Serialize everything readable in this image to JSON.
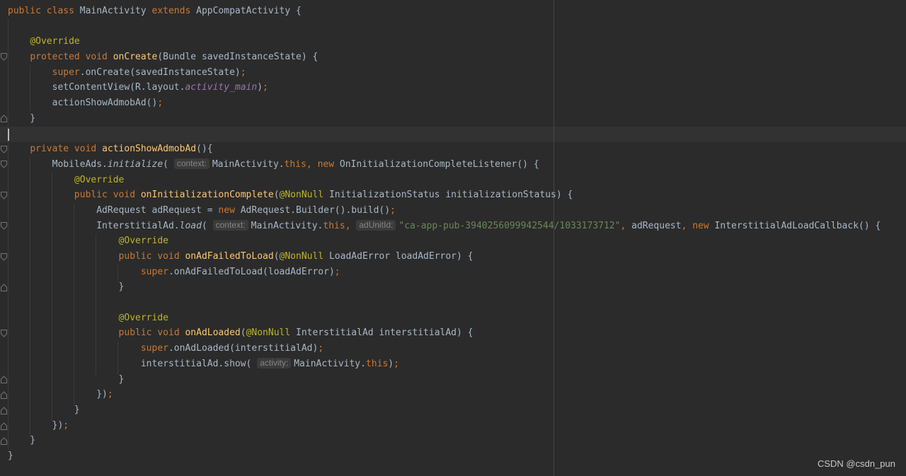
{
  "editor": {
    "language": "java",
    "colors": {
      "background": "#2b2b2b",
      "current_line": "#323232",
      "plain": "#a9b7c6",
      "keyword": "#cc7832",
      "annotation": "#bbb529",
      "method_declaration": "#ffc66d",
      "field": "#9876aa",
      "string": "#6a8759",
      "inlay_hint_text": "#858585",
      "inlay_hint_background": "#3b3b3b"
    },
    "lines": [
      [
        {
          "t": "keyword",
          "v": "public class "
        },
        {
          "t": "plain",
          "v": "MainActivity "
        },
        {
          "t": "keyword",
          "v": "extends "
        },
        {
          "t": "plain",
          "v": "AppCompatActivity {"
        }
      ],
      [],
      [
        {
          "t": "plain",
          "v": "    "
        },
        {
          "t": "annotation",
          "v": "@Override"
        }
      ],
      [
        {
          "t": "plain",
          "v": "    "
        },
        {
          "t": "keyword",
          "v": "protected void "
        },
        {
          "t": "method-decl",
          "v": "onCreate"
        },
        {
          "t": "plain",
          "v": "(Bundle savedInstanceState) {"
        }
      ],
      [
        {
          "t": "plain",
          "v": "        "
        },
        {
          "t": "keyword",
          "v": "super"
        },
        {
          "t": "plain",
          "v": ".onCreate(savedInstanceState)"
        },
        {
          "t": "punct",
          "v": ";"
        }
      ],
      [
        {
          "t": "plain",
          "v": "        setContentView(R.layout."
        },
        {
          "t": "field-ref",
          "v": "activity_main"
        },
        {
          "t": "plain",
          "v": ")"
        },
        {
          "t": "punct",
          "v": ";"
        }
      ],
      [
        {
          "t": "plain",
          "v": "        actionShowAdmobAd()"
        },
        {
          "t": "punct",
          "v": ";"
        }
      ],
      [
        {
          "t": "plain",
          "v": "    }"
        }
      ],
      [],
      [
        {
          "t": "plain",
          "v": "    "
        },
        {
          "t": "keyword",
          "v": "private void "
        },
        {
          "t": "method-decl",
          "v": "actionShowAdmobAd"
        },
        {
          "t": "plain",
          "v": "(){"
        }
      ],
      [
        {
          "t": "plain",
          "v": "        MobileAds."
        },
        {
          "t": "static-call",
          "v": "initialize"
        },
        {
          "t": "plain",
          "v": "( "
        },
        {
          "t": "hint",
          "v": "context:"
        },
        {
          "t": "plain",
          "v": "MainActivity."
        },
        {
          "t": "keyword",
          "v": "this, new "
        },
        {
          "t": "plain",
          "v": "OnInitializationCompleteListener() {"
        }
      ],
      [
        {
          "t": "plain",
          "v": "            "
        },
        {
          "t": "annotation",
          "v": "@Override"
        }
      ],
      [
        {
          "t": "plain",
          "v": "            "
        },
        {
          "t": "keyword",
          "v": "public void "
        },
        {
          "t": "method-decl",
          "v": "onInitializationComplete"
        },
        {
          "t": "plain",
          "v": "("
        },
        {
          "t": "annotation",
          "v": "@NonNull "
        },
        {
          "t": "plain",
          "v": "InitializationStatus initializationStatus) {"
        }
      ],
      [
        {
          "t": "plain",
          "v": "                AdRequest adRequest = "
        },
        {
          "t": "keyword",
          "v": "new "
        },
        {
          "t": "plain",
          "v": "AdRequest.Builder().build()"
        },
        {
          "t": "punct",
          "v": ";"
        }
      ],
      [
        {
          "t": "plain",
          "v": "                InterstitialAd."
        },
        {
          "t": "static-call",
          "v": "load"
        },
        {
          "t": "plain",
          "v": "( "
        },
        {
          "t": "hint",
          "v": "context:"
        },
        {
          "t": "plain",
          "v": "MainActivity."
        },
        {
          "t": "keyword",
          "v": "this, "
        },
        {
          "t": "hint",
          "v": "adUnitId:"
        },
        {
          "t": "string",
          "v": "\"ca-app-pub-3940256099942544/1033173712\""
        },
        {
          "t": "punct",
          "v": ", "
        },
        {
          "t": "plain",
          "v": "adRequest"
        },
        {
          "t": "punct",
          "v": ", "
        },
        {
          "t": "keyword",
          "v": "new "
        },
        {
          "t": "plain",
          "v": "InterstitialAdLoadCallback() {"
        }
      ],
      [
        {
          "t": "plain",
          "v": "                    "
        },
        {
          "t": "annotation",
          "v": "@Override"
        }
      ],
      [
        {
          "t": "plain",
          "v": "                    "
        },
        {
          "t": "keyword",
          "v": "public void "
        },
        {
          "t": "method-decl",
          "v": "onAdFailedToLoad"
        },
        {
          "t": "plain",
          "v": "("
        },
        {
          "t": "annotation",
          "v": "@NonNull "
        },
        {
          "t": "plain",
          "v": "LoadAdError loadAdError) {"
        }
      ],
      [
        {
          "t": "plain",
          "v": "                        "
        },
        {
          "t": "keyword",
          "v": "super"
        },
        {
          "t": "plain",
          "v": ".onAdFailedToLoad(loadAdError)"
        },
        {
          "t": "punct",
          "v": ";"
        }
      ],
      [
        {
          "t": "plain",
          "v": "                    }"
        }
      ],
      [],
      [
        {
          "t": "plain",
          "v": "                    "
        },
        {
          "t": "annotation",
          "v": "@Override"
        }
      ],
      [
        {
          "t": "plain",
          "v": "                    "
        },
        {
          "t": "keyword",
          "v": "public void "
        },
        {
          "t": "method-decl",
          "v": "onAdLoaded"
        },
        {
          "t": "plain",
          "v": "("
        },
        {
          "t": "annotation",
          "v": "@NonNull "
        },
        {
          "t": "plain",
          "v": "InterstitialAd interstitialAd) {"
        }
      ],
      [
        {
          "t": "plain",
          "v": "                        "
        },
        {
          "t": "keyword",
          "v": "super"
        },
        {
          "t": "plain",
          "v": ".onAdLoaded(interstitialAd)"
        },
        {
          "t": "punct",
          "v": ";"
        }
      ],
      [
        {
          "t": "plain",
          "v": "                        interstitialAd.show( "
        },
        {
          "t": "hint",
          "v": "activity:"
        },
        {
          "t": "plain",
          "v": "MainActivity."
        },
        {
          "t": "keyword",
          "v": "this"
        },
        {
          "t": "plain",
          "v": ")"
        },
        {
          "t": "punct",
          "v": ";"
        }
      ],
      [
        {
          "t": "plain",
          "v": "                    }"
        }
      ],
      [
        {
          "t": "plain",
          "v": "                })"
        },
        {
          "t": "punct",
          "v": ";"
        }
      ],
      [
        {
          "t": "plain",
          "v": "            }"
        }
      ],
      [
        {
          "t": "plain",
          "v": "        })"
        },
        {
          "t": "punct",
          "v": ";"
        }
      ],
      [
        {
          "t": "plain",
          "v": "    }"
        }
      ],
      [
        {
          "t": "plain",
          "v": "}"
        }
      ]
    ]
  },
  "watermark": {
    "text": "CSDN @csdn_pun"
  }
}
